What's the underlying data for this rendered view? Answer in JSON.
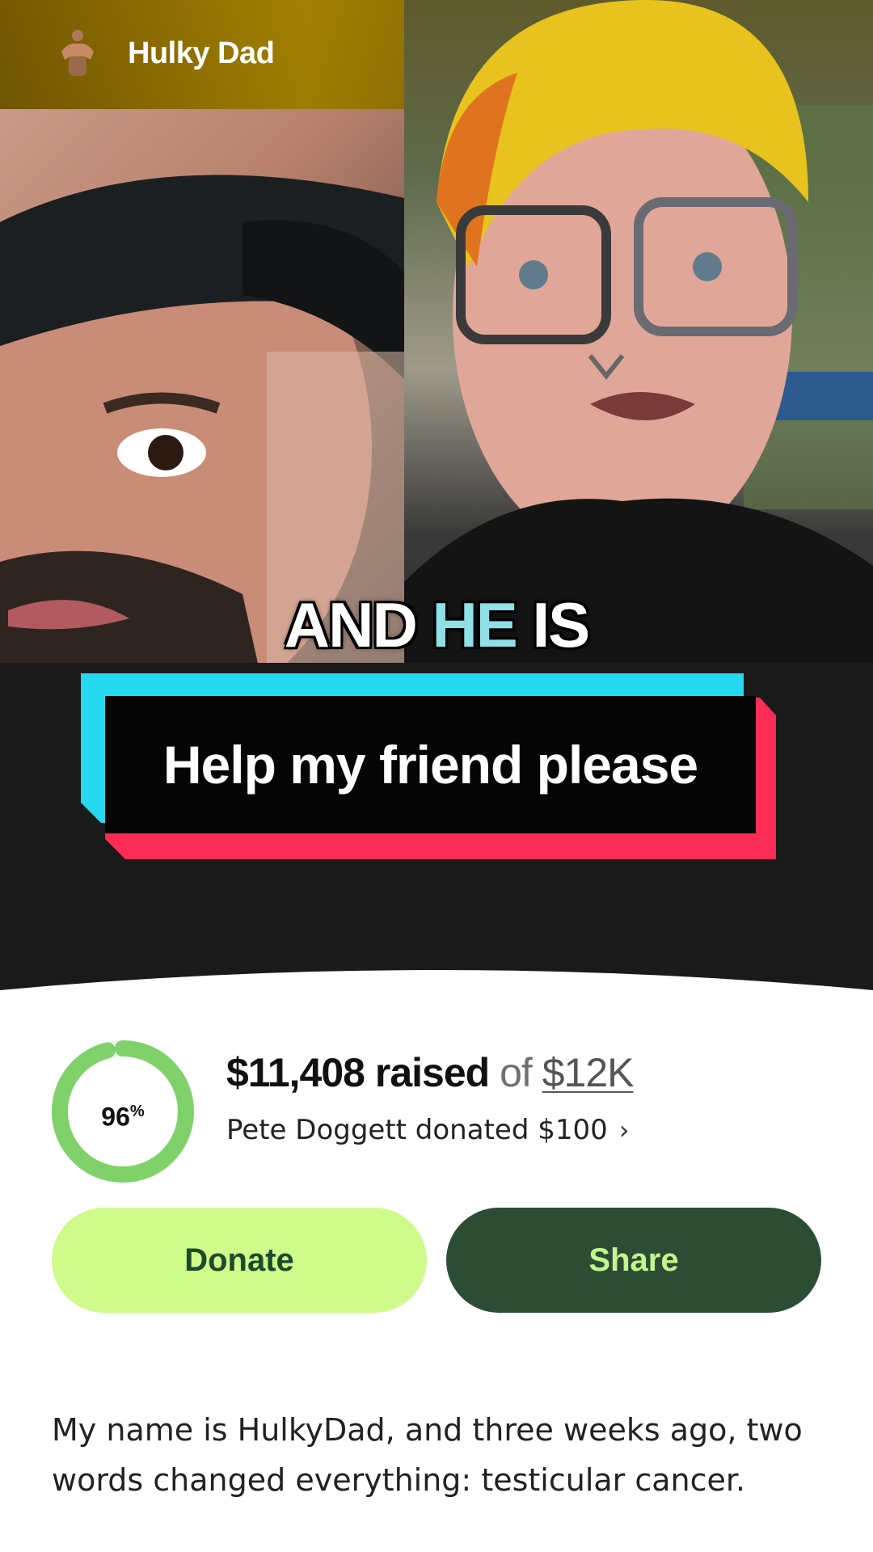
{
  "header": {
    "account_name": "Hulky Dad",
    "avatar_icon": "flexing-man-icon"
  },
  "video": {
    "caption_words": [
      "AND",
      "HE",
      "IS"
    ],
    "banner_text": "Help my friend please",
    "colors": {
      "highlight": "#8fe0e6",
      "banner_cyan": "#25d9f0",
      "banner_red": "#fb2c55"
    }
  },
  "fundraiser": {
    "progress_percent": 96,
    "progress_label": "96",
    "progress_unit": "%",
    "raised_amount": "$11,408 raised",
    "of_text": "of",
    "goal": "$12K",
    "recent_donation": "Pete Doggett donated $100",
    "donate_label": "Donate",
    "share_label": "Share",
    "story": "My name is HulkyDad, and three weeks ago, two words changed everything: testicular cancer.",
    "colors": {
      "progress": "#7fd16a",
      "donate_bg": "#cffb8a",
      "share_bg": "#2c4d34"
    }
  }
}
